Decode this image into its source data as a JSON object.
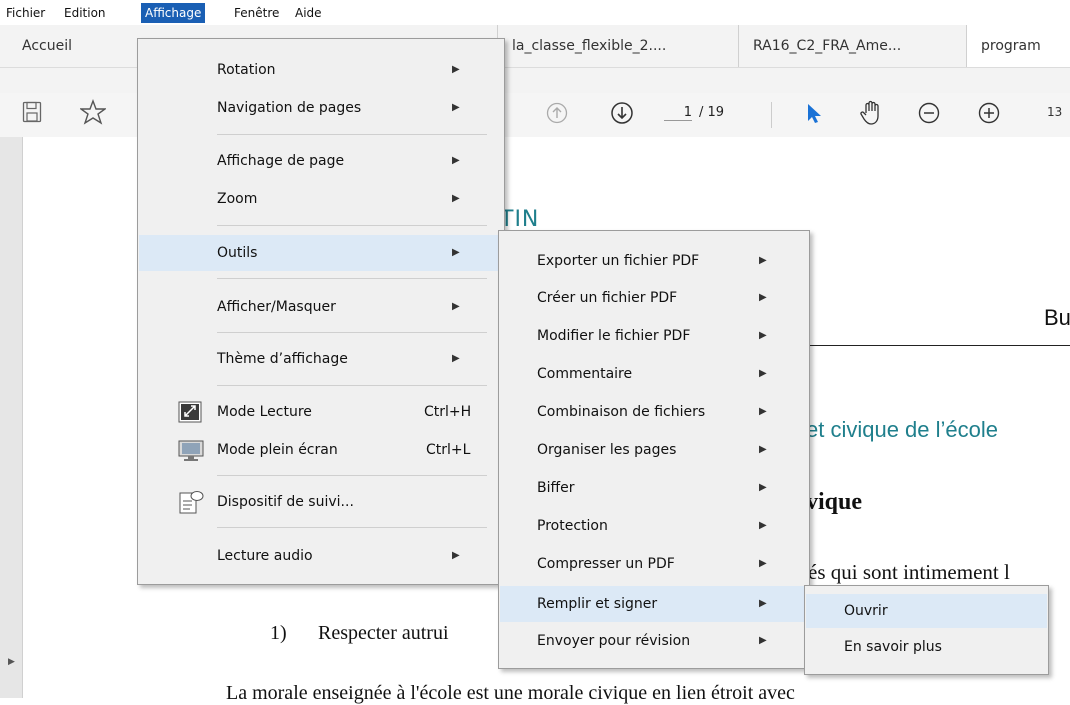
{
  "menubar": {
    "items": [
      "Fichier",
      "Edition",
      "Affichage",
      "Fenêtre",
      "Aide"
    ]
  },
  "tabs": {
    "home": "Accueil",
    "docs": [
      "la_classe_flexible_2....",
      "RA16_C2_FRA_Ame...",
      "program"
    ]
  },
  "toolbar": {
    "page_current": "1",
    "page_total": "/ 19",
    "zoom_partial": "13"
  },
  "document": {
    "heading_partial": "TIN",
    "bu_text": "Bu",
    "section_title": "et civique de l’école",
    "subheading": "vique",
    "line1": "és qui sont intimement l",
    "line2_num": "1)",
    "line2_text": "Respecter autrui",
    "bottom_line": "La morale enseignée à l'école est une morale civique en lien étroit avec"
  },
  "menu_affichage": {
    "rotation": "Rotation",
    "navigation": "Navigation de pages",
    "affichage_page": "Affichage de page",
    "zoom": "Zoom",
    "outils": "Outils",
    "afficher_masquer": "Afficher/Masquer",
    "theme": "Thème d’affichage",
    "mode_lecture": "Mode Lecture",
    "mode_lecture_sc": "Ctrl+H",
    "plein_ecran": "Mode plein écran",
    "plein_ecran_sc": "Ctrl+L",
    "dispositif": "Dispositif de suivi...",
    "lecture_audio": "Lecture audio"
  },
  "menu_outils": [
    "Exporter un fichier PDF",
    "Créer un fichier PDF",
    "Modifier le fichier PDF",
    "Commentaire",
    "Combinaison de fichiers",
    "Organiser les pages",
    "Biffer",
    "Protection",
    "Compresser un PDF",
    "Remplir et signer",
    "Envoyer pour révision"
  ],
  "menu_remplir": [
    "Ouvrir",
    "En savoir plus"
  ],
  "colors": {
    "menubar_active": "#1a5fb4",
    "highlight": "#dce9f6",
    "accent_blue": "#1a72d6",
    "teal_heading": "#1f7f8c"
  }
}
